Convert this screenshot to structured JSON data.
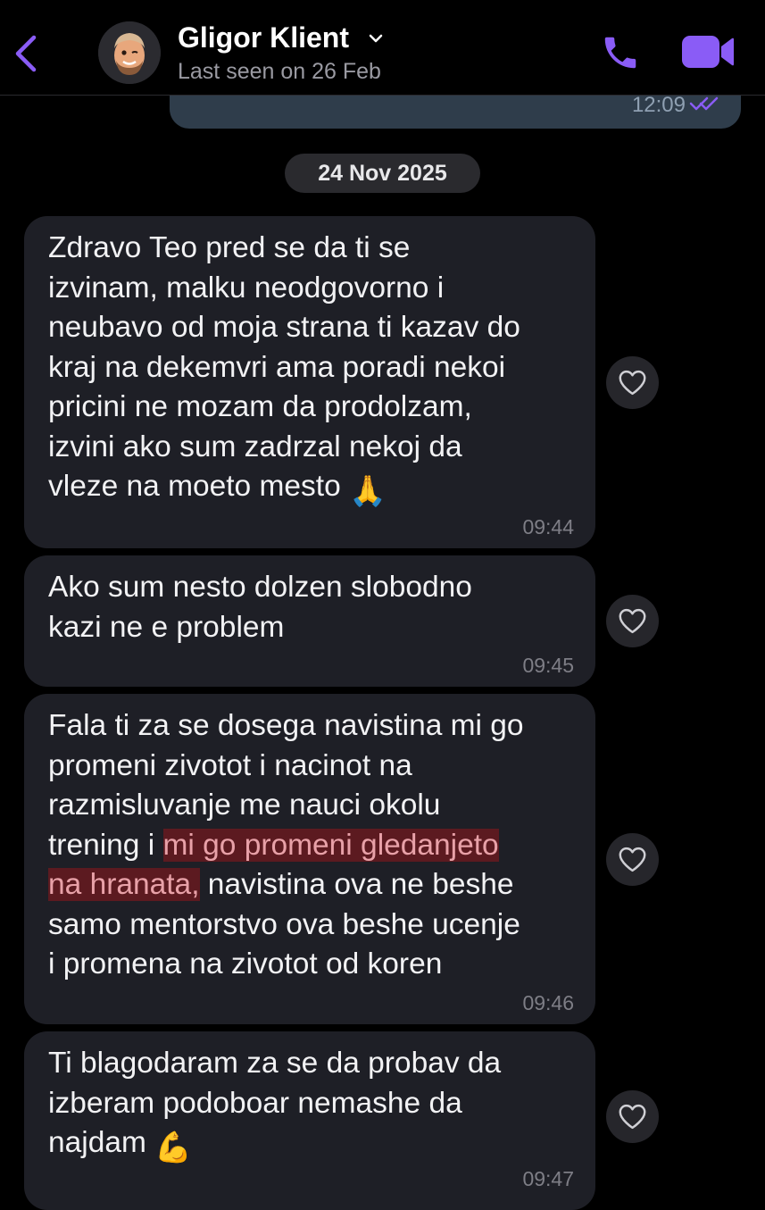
{
  "header": {
    "contact_name": "Gligor Klient",
    "status": "Last seen on 26 Feb",
    "back_icon": "chevron-left-icon",
    "dropdown_icon": "chevron-down-icon",
    "call_icon": "phone-icon",
    "video_icon": "video-camera-icon",
    "accent_color": "#8a5cf6"
  },
  "previous_message": {
    "time": "12:09",
    "status_icon": "double-check-icon"
  },
  "date_separator": "24 Nov 2025",
  "messages": [
    {
      "text": "Zdravo Teo pred se da ti se\nizvinam, malku neodgovorno i\nneubavo od moja strana ti kazav do\nkraj na dekemvri ama poradi nekoi\npricini ne mozam da prodolzam,\nizvini ako sum zadrzal nekoj da\nvleze na moeto mesto",
      "emoji": "🙏",
      "time": "09:44"
    },
    {
      "text": "Ako sum nesto dolzen slobodno\nkazi ne e problem",
      "time": "09:45"
    },
    {
      "text_before": "Fala ti za se dosega navistina mi go\npromeni zivotot i nacinot na\nrazmisluvanje me nauci okolu\ntrening i ",
      "text_highlight_1": "mi go promeni gledanjeto",
      "text_highlight_2": "na hranata,",
      "text_after": " navistina ova ne beshe\nsamo mentorstvo ova beshe ucenje\ni promena na zivotot od koren",
      "highlight_color": "#5c1a20",
      "time": "09:46"
    },
    {
      "text": "Ti blagodaram za se da probav da\nizberam podoboar nemashe da\nnajdam",
      "emoji": "💪",
      "time": "09:47"
    }
  ],
  "reaction_icon": "heart-outline-icon"
}
